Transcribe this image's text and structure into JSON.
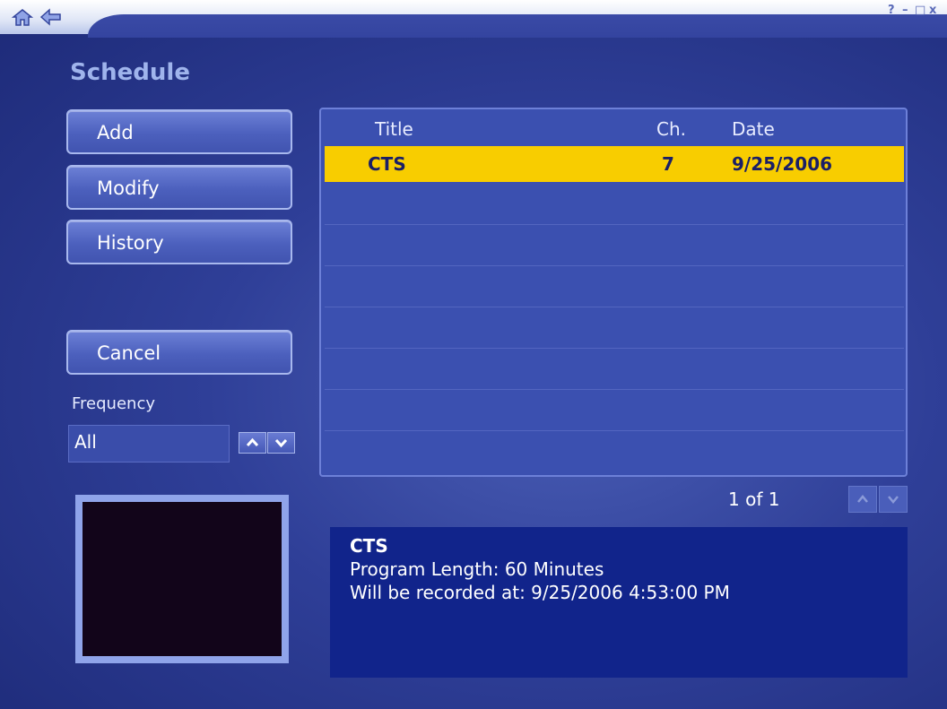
{
  "window": {
    "controls": {
      "help": "?",
      "minimize": "–",
      "maximize": "□",
      "close": "x"
    }
  },
  "page": {
    "title": "Schedule"
  },
  "actions": {
    "add": "Add",
    "modify": "Modify",
    "history": "History",
    "cancel": "Cancel"
  },
  "frequency": {
    "label": "Frequency",
    "value": "All"
  },
  "list": {
    "columns": {
      "title": "Title",
      "channel": "Ch.",
      "date": "Date"
    },
    "rows": [
      {
        "title": "CTS",
        "channel": "7",
        "date": "9/25/2006"
      }
    ],
    "pager": "1 of 1"
  },
  "details": {
    "title": "CTS",
    "length": "Program Length: 60 Minutes",
    "record_time": "Will be recorded at: 9/25/2006 4:53:00 PM"
  },
  "icons": [
    "home-icon",
    "back-arrow-icon",
    "help-icon",
    "minimize-icon",
    "maximize-icon",
    "close-icon",
    "up-arrow-icon",
    "down-arrow-icon"
  ],
  "colors": {
    "selected_row": "#f8cd00",
    "title": "#9fb4ec",
    "info_panel": "#11248b"
  }
}
